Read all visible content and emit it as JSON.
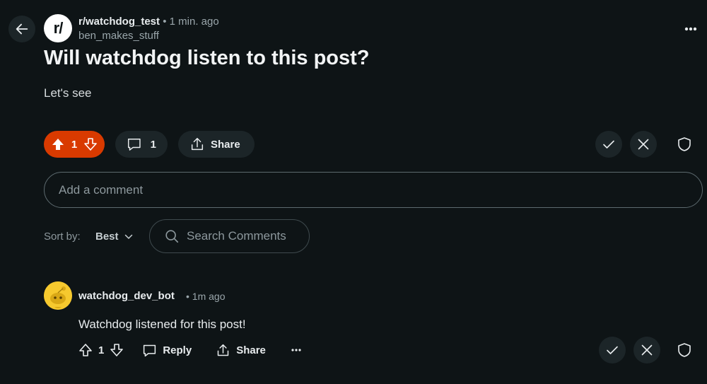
{
  "post": {
    "subreddit": "r/watchdog_test",
    "separator": "•",
    "time": "1 min. ago",
    "author": "ben_makes_stuff",
    "logo_text": "r/",
    "title": "Will watchdog listen to this post?",
    "body": "Let's see",
    "vote_count": "1",
    "comment_count": "1",
    "share_label": "Share"
  },
  "comment_input": {
    "placeholder": "Add a comment"
  },
  "sort": {
    "label": "Sort by:",
    "value": "Best"
  },
  "search": {
    "placeholder": "Search Comments"
  },
  "comment": {
    "username": "watchdog_dev_bot",
    "separator": "•",
    "time": "1m ago",
    "text": "Watchdog listened for this post!",
    "vote_count": "1",
    "reply_label": "Reply",
    "share_label": "Share"
  },
  "icons": [
    "back-arrow-icon",
    "more-horizontal-icon",
    "upvote-icon",
    "downvote-icon",
    "comment-icon",
    "share-icon",
    "check-icon",
    "close-icon",
    "shield-icon",
    "search-icon",
    "chevron-down-icon"
  ],
  "colors": {
    "background": "#0e1416",
    "upvote_active": "#d93a00",
    "button_bg": "#1c2528",
    "avatar": "#f6c92e"
  }
}
